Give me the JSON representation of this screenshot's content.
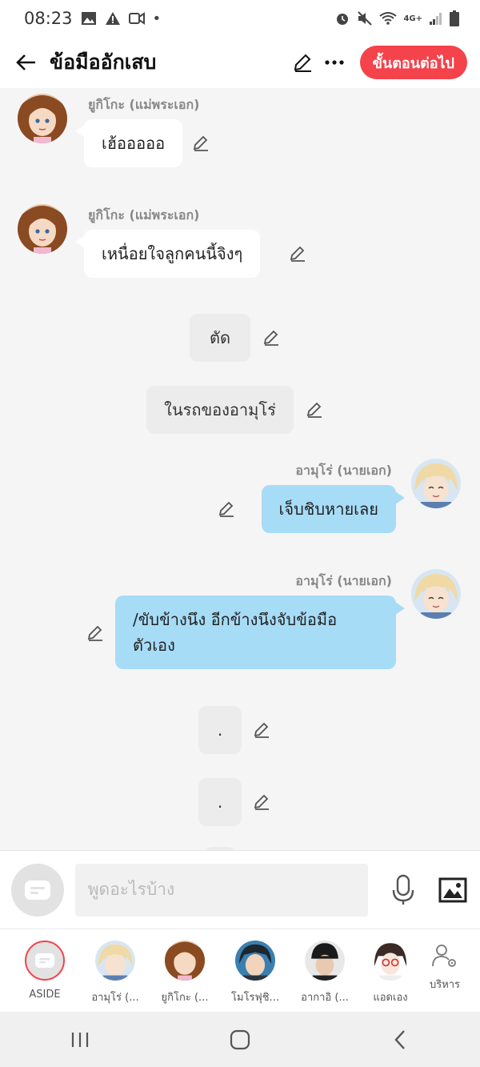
{
  "status": {
    "time": "08:23",
    "icons_left": [
      "image-icon",
      "warning-icon",
      "video-icon",
      "dot-icon"
    ],
    "icons_right": [
      "alarm-icon",
      "mute-icon",
      "wifi-icon",
      "4g-icon",
      "signal-icon",
      "battery-icon"
    ],
    "network": "4G+"
  },
  "header": {
    "title": "ข้อมืออักเสบ",
    "next_label": "ขั้นตอนต่อไป"
  },
  "messages": [
    {
      "type": "left",
      "speaker": "ยูกิโกะ (แม่พระเอก)",
      "text": "เฮ้อออออ"
    },
    {
      "type": "left",
      "speaker": "ยูกิโกะ (แม่พระเอก)",
      "text": "เหนื่อยใจลูกคนนี้จิงๆ"
    },
    {
      "type": "narration",
      "text": "ตัด"
    },
    {
      "type": "narration",
      "text": "ในรถของอามุโร่"
    },
    {
      "type": "right",
      "speaker": "อามุโร่ (นายเอก)",
      "text": "เจ็บชิบหายเลย"
    },
    {
      "type": "right",
      "speaker": "อามุโร่ (นายเอก)",
      "text_line1": "/ขับข้างนึง อีกข้างนึงจับข้อมือ",
      "text_line2": "ตัวเอง"
    },
    {
      "type": "narration",
      "text": "."
    },
    {
      "type": "narration",
      "text": "."
    }
  ],
  "input": {
    "placeholder": "พูดอะไรบ้าง"
  },
  "characters": [
    {
      "name": "ASIDE"
    },
    {
      "name": "อามุโร่ (..."
    },
    {
      "name": "ยูกิโกะ (..."
    },
    {
      "name": "โมโรฟุชิ..."
    },
    {
      "name": "อากาอิ (..."
    },
    {
      "name": "แอดเอง"
    }
  ],
  "manage_label": "บริหาร",
  "colors": {
    "accent": "#f4434b",
    "right_bubble": "#a7dcf7",
    "left_bubble": "#ffffff",
    "narration_bubble": "#ececec",
    "background": "#f5f5f5"
  }
}
